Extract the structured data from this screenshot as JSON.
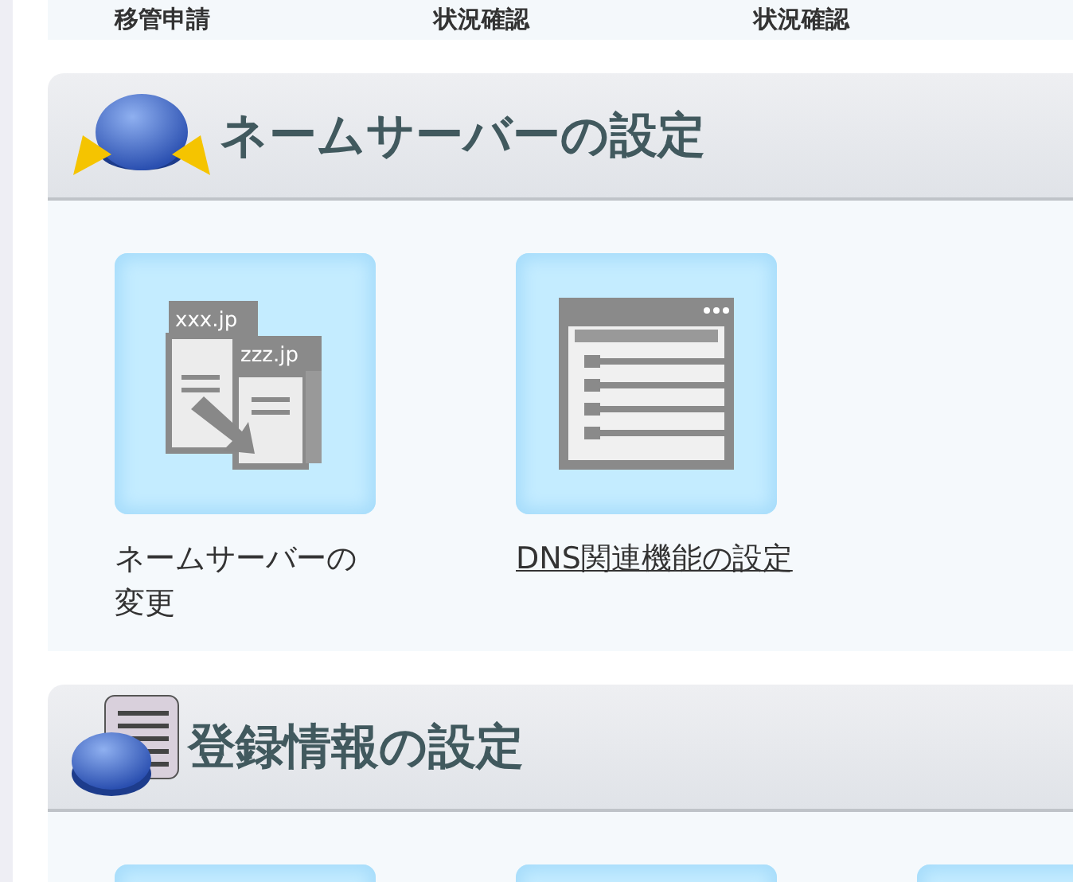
{
  "top_row": [
    "移管申請",
    "状況確認",
    "状況確認"
  ],
  "sections": [
    {
      "title": "ネームサーバーの設定",
      "items": [
        {
          "kind": "transfer",
          "label": "ネームサーバーの変更",
          "link": false,
          "icon_text": [
            "xxx.jp",
            "zzz.jp"
          ]
        },
        {
          "kind": "checklist",
          "label": "DNS関連機能の設定",
          "link": true
        }
      ]
    },
    {
      "title": "登録情報の設定",
      "items": [
        {
          "kind": "blank"
        },
        {
          "kind": "blank"
        },
        {
          "kind": "blank"
        }
      ]
    }
  ]
}
